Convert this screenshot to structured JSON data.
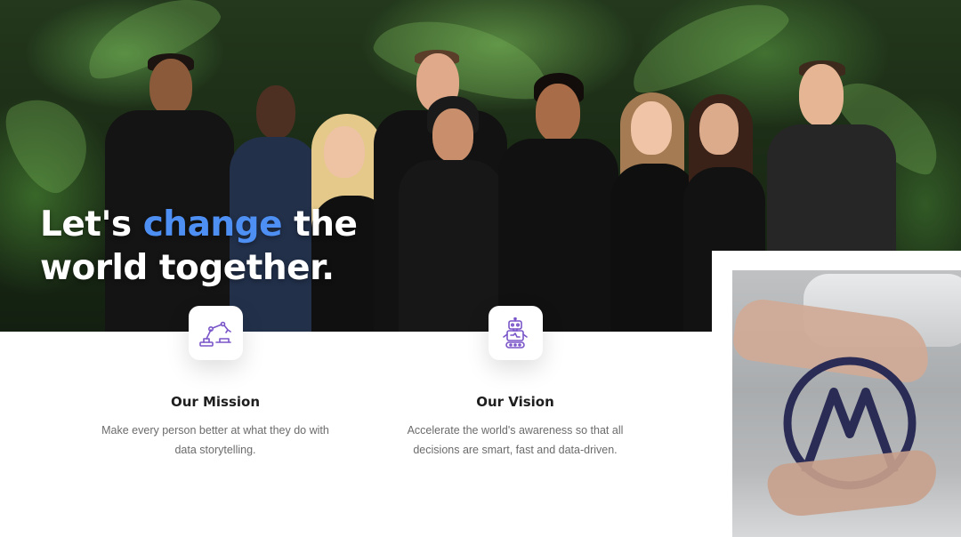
{
  "hero": {
    "headline_before": "Let's ",
    "headline_accent": "change",
    "headline_after": " the",
    "headline_line2": "world together.",
    "accent_color": "#4d8ff3"
  },
  "features": [
    {
      "icon": "robot-arm-icon",
      "title": "Our Mission",
      "text": "Make every person better at what they do with data storytelling."
    },
    {
      "icon": "robot-icon",
      "title": "Our Vision",
      "text": "Accelerate the world's awareness so that all decisions are smart, fast and data-driven."
    }
  ],
  "icon_color": "#7a55c9",
  "side_image": {
    "icon": "vr-hands-logo-icon"
  }
}
